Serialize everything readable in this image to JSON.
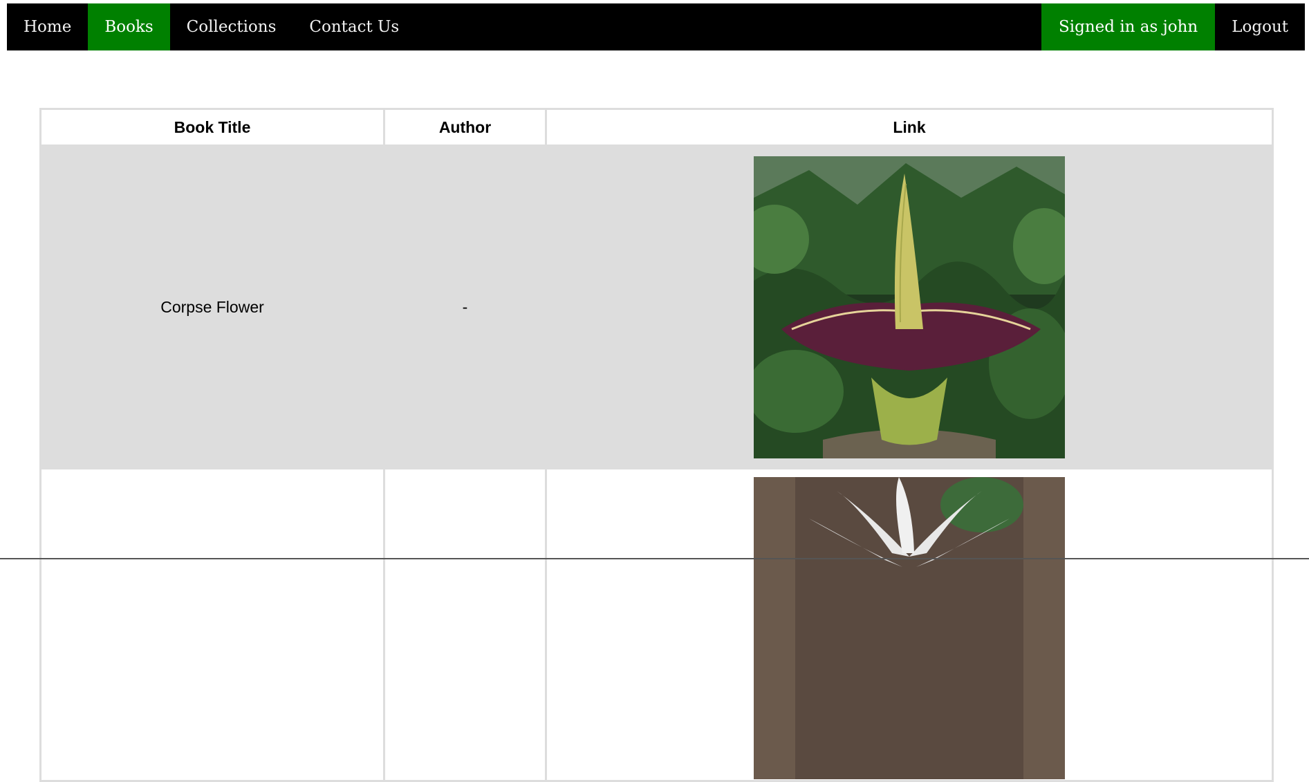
{
  "nav": {
    "items": [
      {
        "label": "Home",
        "active": false
      },
      {
        "label": "Books",
        "active": true
      },
      {
        "label": "Collections",
        "active": false
      },
      {
        "label": "Contact Us",
        "active": false
      }
    ],
    "signed_in": "Signed in as john",
    "logout": "Logout"
  },
  "table": {
    "headers": {
      "title": "Book Title",
      "author": "Author",
      "link": "Link"
    },
    "rows": [
      {
        "title": "Corpse Flower",
        "author": "-",
        "image": "corpse-flower-photo"
      },
      {
        "title": "",
        "author": "",
        "image": "white-flower-photo"
      }
    ]
  },
  "colors": {
    "nav_bg": "#000000",
    "active_bg": "#008000",
    "row_alt_bg": "#dddddd"
  }
}
